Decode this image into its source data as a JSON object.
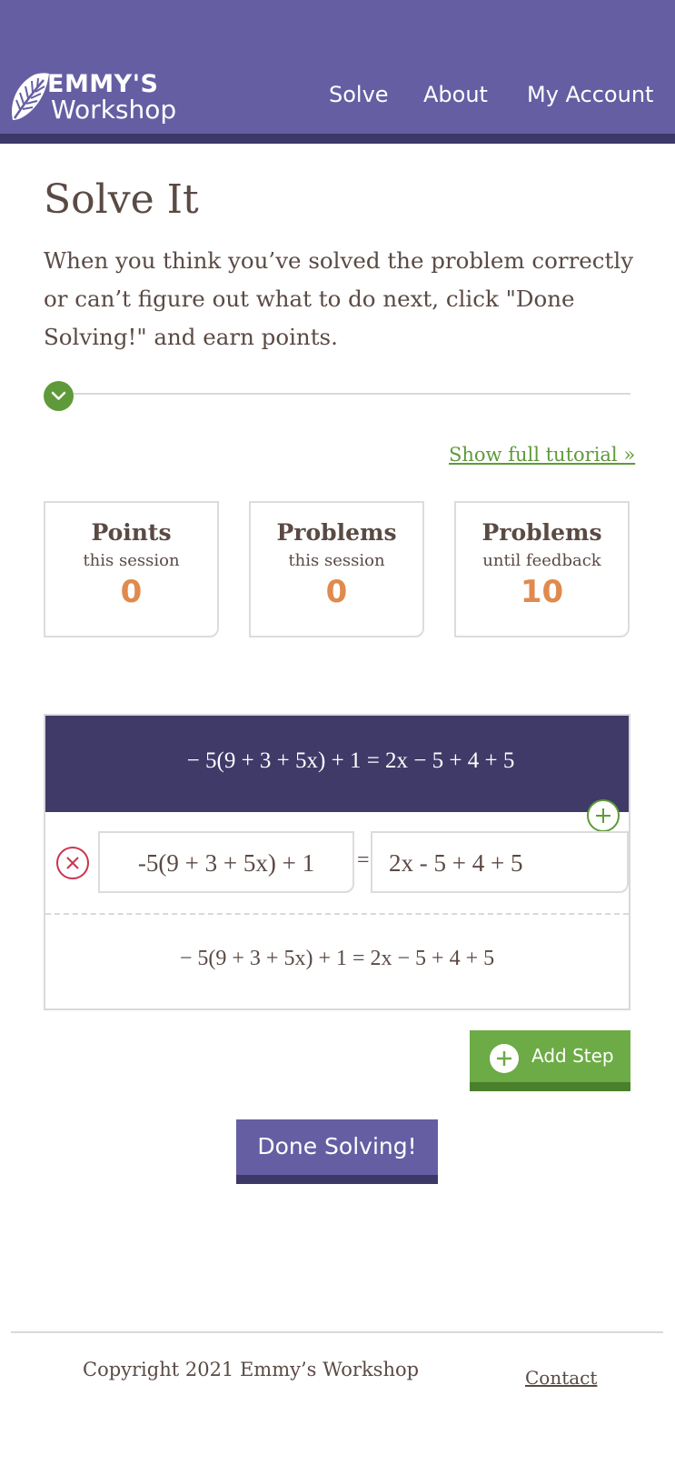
{
  "header": {
    "logo_line1": "EMMY'S",
    "logo_line2": "Workshop",
    "nav": [
      "Solve",
      "About",
      "My Account"
    ]
  },
  "main": {
    "title": "Solve It",
    "intro": "When you think you’ve solved the problem correctly or can’t figure out what to do next, click \"Done Solving!\" and earn points.",
    "tutorial_link": "Show full tutorial »",
    "stats": [
      {
        "title": "Points",
        "subtitle": "this session",
        "value": "0"
      },
      {
        "title": "Problems",
        "subtitle": "this session",
        "value": "0"
      },
      {
        "title": "Problems",
        "subtitle": "until feedback",
        "value": "10"
      }
    ]
  },
  "solver": {
    "problem": "− 5(9 + 3 + 5x) + 1 = 2x − 5 + 4 + 5",
    "step_left_value": "-5(9 + 3 + 5x) + 1",
    "equals": "=",
    "step_right_value": "2x - 5 + 4 + 5",
    "preview": "− 5(9 + 3 + 5x) + 1 = 2x − 5 + 4 + 5"
  },
  "buttons": {
    "add_step": "Add Step",
    "done": "Done Solving!"
  },
  "footer": {
    "copyright": "Copyright 2021 Emmy’s Workshop",
    "contact": "Contact"
  },
  "colors": {
    "header": "#665ea3",
    "header_bar": "#3d3868",
    "problem_bg": "#3f3a68",
    "accent_green": "#6cab45",
    "stat_orange": "#e08a4e",
    "remove_red": "#c9344f"
  },
  "icons": [
    "leaf-logo-icon",
    "check-circle-icon",
    "plus-circle-icon",
    "remove-x-icon"
  ]
}
